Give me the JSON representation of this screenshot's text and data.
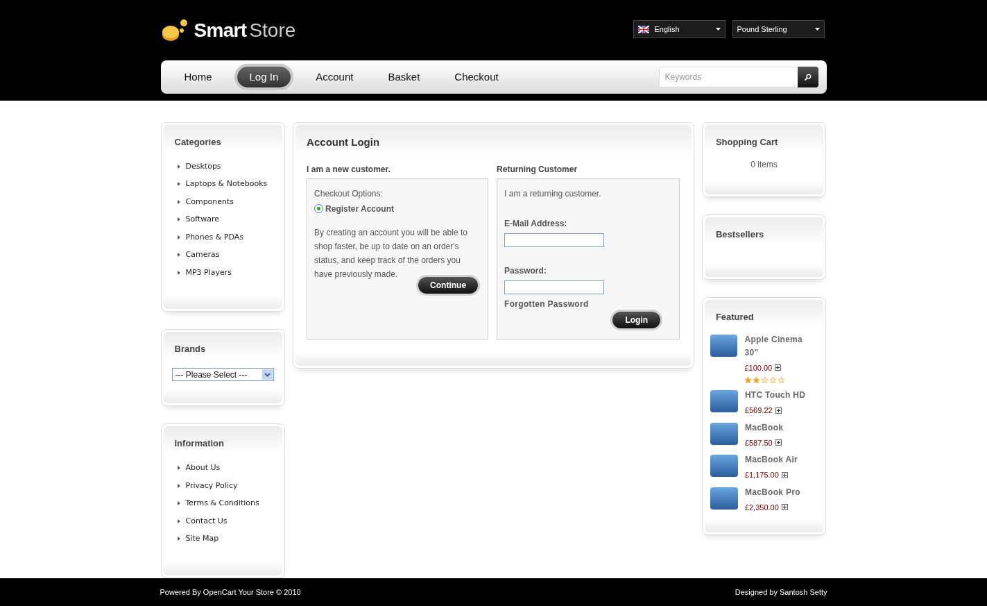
{
  "logo": {
    "bold": "Smart",
    "light": "Store"
  },
  "language": {
    "value": "English"
  },
  "currency": {
    "value": "Pound Sterling"
  },
  "nav": [
    {
      "label": "Home",
      "selected": false
    },
    {
      "label": "Log In",
      "selected": true
    },
    {
      "label": "Account",
      "selected": false
    },
    {
      "label": "Basket",
      "selected": false
    },
    {
      "label": "Checkout",
      "selected": false
    }
  ],
  "search": {
    "placeholder": "Keywords"
  },
  "categories": {
    "title": "Categories",
    "items": [
      "Desktops",
      "Laptops & Notebooks",
      "Components",
      "Software",
      "Phones & PDAs",
      "Cameras",
      "MP3 Players"
    ]
  },
  "brands": {
    "title": "Brands",
    "value": "--- Please Select ---"
  },
  "information": {
    "title": "Information",
    "items": [
      "About Us",
      "Privacy Policy",
      "Terms & Conditions",
      "Contact Us",
      "Site Map"
    ]
  },
  "login": {
    "title": "Account Login",
    "new_customer": {
      "heading": "I am a new customer.",
      "options_label": "Checkout Options:",
      "options": [
        {
          "label": "Register Account",
          "selected": true
        }
      ],
      "text": "By creating an account you will be able to shop faster, be up to date on an order's status, and keep track of the orders you have previously made.",
      "button": "Continue"
    },
    "returning": {
      "heading": "Returning Customer",
      "text": "I am a returning customer.",
      "email_label": "E-Mail Address:",
      "password_label": "Password:",
      "forgotten": "Forgotten Password",
      "button": "Login"
    }
  },
  "cart": {
    "title": "Shopping Cart",
    "text": "0 items"
  },
  "bestsellers": {
    "title": "Bestsellers"
  },
  "featured": {
    "title": "Featured",
    "products": [
      {
        "name": "Apple Cinema 30\"",
        "price": "£100.00",
        "stars": 2
      },
      {
        "name": "HTC Touch HD",
        "price": "£569.22"
      },
      {
        "name": "MacBook",
        "price": "£587.50"
      },
      {
        "name": "MacBook Air",
        "price": "£1,175.00"
      },
      {
        "name": "MacBook Pro",
        "price": "£2,350.00"
      }
    ]
  },
  "footer": {
    "left": "Powered By OpenCart Your Store © 2010",
    "right": "Designed by Santosh Setty"
  }
}
